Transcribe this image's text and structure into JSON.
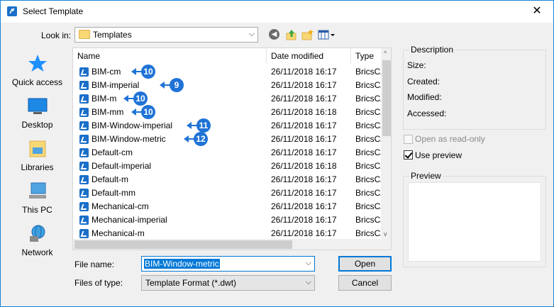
{
  "window": {
    "title": "Select Template",
    "close_glyph": "✕",
    "accent": "#1883d7"
  },
  "lookin": {
    "label": "Look in:",
    "value": "Templates"
  },
  "toolbar": {
    "back_icon": "back-arrow-icon",
    "up_icon": "up-folder-icon",
    "newfolder_icon": "new-folder-icon",
    "views_icon": "views-menu-icon"
  },
  "places": [
    {
      "label": "Quick access",
      "icon": "star-icon"
    },
    {
      "label": "Desktop",
      "icon": "desktop-icon"
    },
    {
      "label": "Libraries",
      "icon": "libraries-icon"
    },
    {
      "label": "This PC",
      "icon": "computer-icon"
    },
    {
      "label": "Network",
      "icon": "network-icon"
    }
  ],
  "columns": [
    "Name",
    "Date modified",
    "Type"
  ],
  "files": [
    {
      "name": "BIM-cm",
      "date": "26/11/2018 16:17",
      "type": "BricsCAD",
      "callout": "10"
    },
    {
      "name": "BIM-imperial",
      "date": "26/11/2018 16:17",
      "type": "BricsCAD",
      "callout": "9"
    },
    {
      "name": "BIM-m",
      "date": "26/11/2018 16:17",
      "type": "BricsCAD",
      "callout": "10"
    },
    {
      "name": "BIM-mm",
      "date": "26/11/2018 16:18",
      "type": "BricsCAD",
      "callout": "10"
    },
    {
      "name": "BIM-Window-imperial",
      "date": "26/11/2018 16:17",
      "type": "BricsCAD",
      "callout": "11"
    },
    {
      "name": "BIM-Window-metric",
      "date": "26/11/2018 16:17",
      "type": "BricsCAD",
      "callout": "12"
    },
    {
      "name": "Default-cm",
      "date": "26/11/2018 16:17",
      "type": "BricsCAD",
      "callout": ""
    },
    {
      "name": "Default-imperial",
      "date": "26/11/2018 16:18",
      "type": "BricsCAD",
      "callout": ""
    },
    {
      "name": "Default-m",
      "date": "26/11/2018 16:17",
      "type": "BricsCAD",
      "callout": ""
    },
    {
      "name": "Default-mm",
      "date": "26/11/2018 16:17",
      "type": "BricsCAD",
      "callout": ""
    },
    {
      "name": "Mechanical-cm",
      "date": "26/11/2018 16:17",
      "type": "BricsCAD",
      "callout": ""
    },
    {
      "name": "Mechanical-imperial",
      "date": "26/11/2018 16:17",
      "type": "BricsCAD",
      "callout": ""
    },
    {
      "name": "Mechanical-m",
      "date": "26/11/2018 16:17",
      "type": "BricsCAD",
      "callout": ""
    }
  ],
  "filename": {
    "label": "File name:",
    "value": "BIM-Window-metric"
  },
  "filetype": {
    "label": "Files of type:",
    "value": "Template Format (*.dwt)"
  },
  "buttons": {
    "open": "Open",
    "cancel": "Cancel"
  },
  "description": {
    "title": "Description",
    "size": "Size:",
    "created": "Created:",
    "modified": "Modified:",
    "accessed": "Accessed:"
  },
  "options": {
    "readonly": "Open as read-only",
    "readonly_checked": false,
    "preview": "Use preview",
    "preview_checked": true
  },
  "preview": {
    "title": "Preview"
  },
  "colors": {
    "callout": "#1f73d6",
    "selection": "#0078d7",
    "file_icon": "#1a6fc9"
  }
}
